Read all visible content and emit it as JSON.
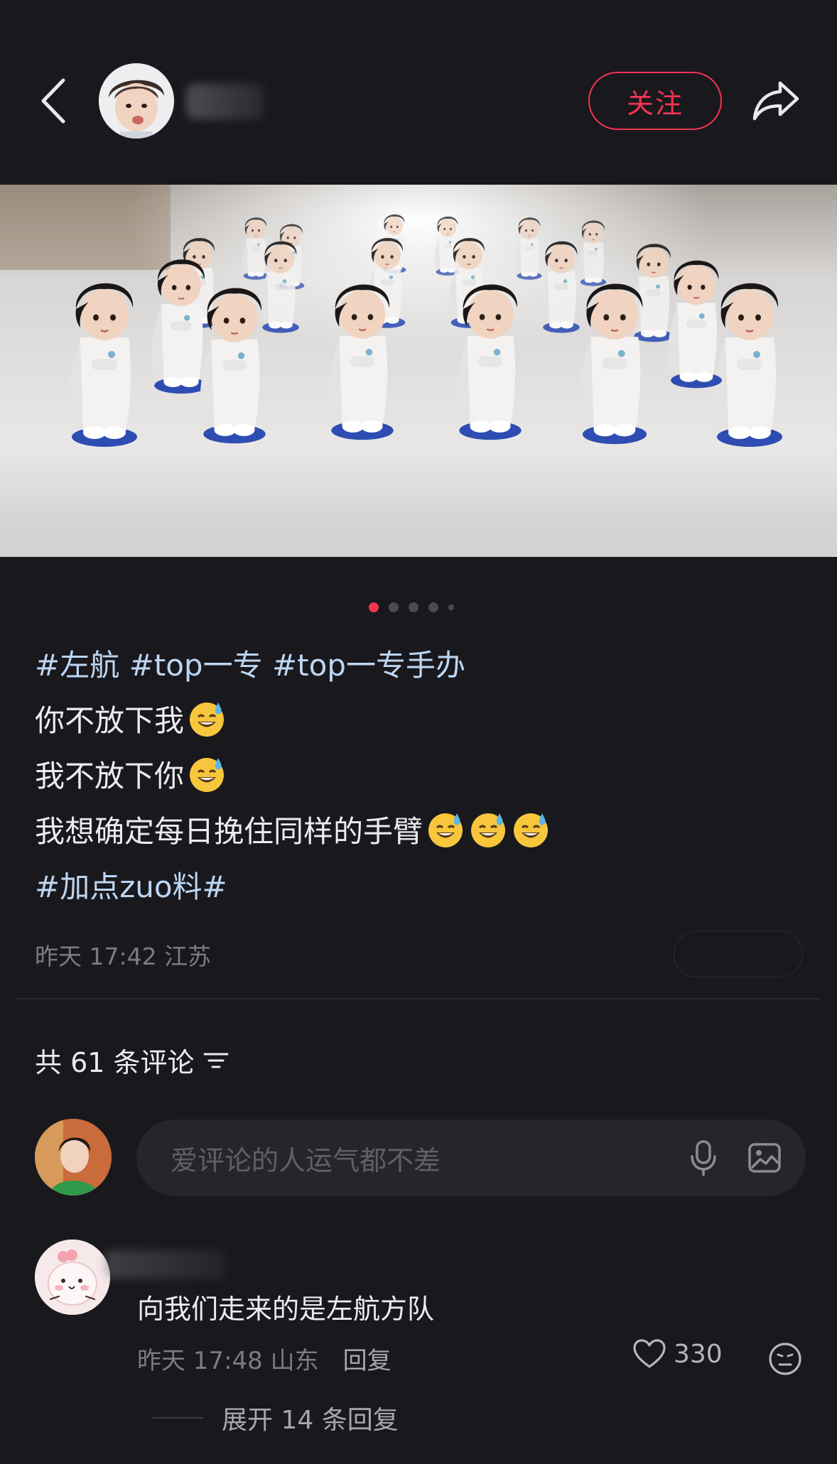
{
  "header": {
    "follow_label": "关注",
    "icons": {
      "back": "chevron-left-icon",
      "share": "share-arrow-icon"
    }
  },
  "photo": {
    "pager": {
      "total": 5,
      "active_index": 0
    }
  },
  "caption": {
    "line1": [
      "#左航",
      "#top一专",
      "#top一专手办"
    ],
    "line2": "你不放下我",
    "line3": "我不放下你",
    "line4": "我想确定每日挽住同样的手臂",
    "line5": "#加点zuo料#",
    "emoji": "sweat-smile-emoji"
  },
  "post_meta": {
    "time_location": "昨天 17:42 江苏"
  },
  "comments": {
    "count_label": "共 61 条评论",
    "input_placeholder": "爱评论的人运气都不差",
    "items": [
      {
        "text": "向我们走来的是左航方队",
        "time_location": "昨天 17:48 山东",
        "reply_label": "回复",
        "likes": "330",
        "expand_label": "展开 14 条回复"
      }
    ]
  },
  "colors": {
    "background": "#19181d",
    "accent": "#f23651",
    "tag": "#bcd6f2"
  }
}
